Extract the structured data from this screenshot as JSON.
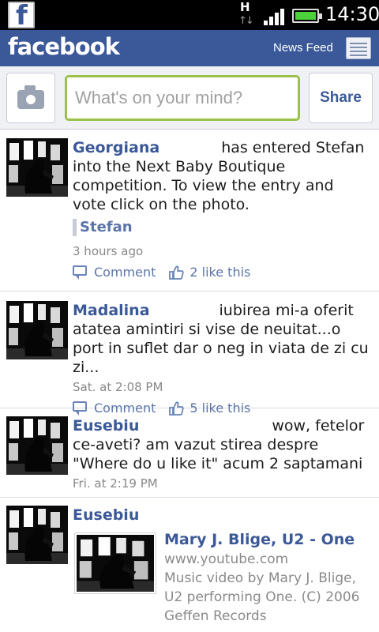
{
  "status_bar": {
    "app_icon": "facebook-f-icon",
    "network_label": "H",
    "signal_icon": "signal-bars-icon",
    "battery_icon": "battery-icon",
    "time": "14:30"
  },
  "header": {
    "logo": "facebook",
    "nav_label": "News Feed",
    "nav_icon": "newspaper-icon",
    "brand_color": "#3b5998"
  },
  "composer": {
    "camera_icon": "camera-icon",
    "placeholder": "What's on your mind?",
    "value": "",
    "share_label": "Share"
  },
  "feed": [
    {
      "author": "Georgiana",
      "text": "has entered Stefan into the Next Baby Boutique competition. To view the entry and vote click on the photo.",
      "tagged": "Stefan",
      "time": "3 hours ago",
      "comment_label": "Comment",
      "likes_label": "2 like this"
    },
    {
      "author": "Madalina",
      "text": "iubirea mi-a oferit atatea amintiri si vise de neuitat...o port in suflet dar o neg in viata de zi cu zi...",
      "time": "Sat. at 2:08 PM",
      "comment_label": "Comment",
      "likes_label": "5 like this"
    },
    {
      "author": "Eusebiu",
      "text": "wow, fetelor ce-aveti? am vazut stirea despre \"Where do u like it\" acum 2 saptamani",
      "time": "Fri. at 2:19 PM"
    },
    {
      "author": "Eusebiu",
      "link": {
        "title": "Mary J. Blige, U2 - One",
        "domain": "www.youtube.com",
        "description": "Music video by Mary J. Blige, U2 performing One. (C) 2006 Geffen Records"
      }
    }
  ]
}
